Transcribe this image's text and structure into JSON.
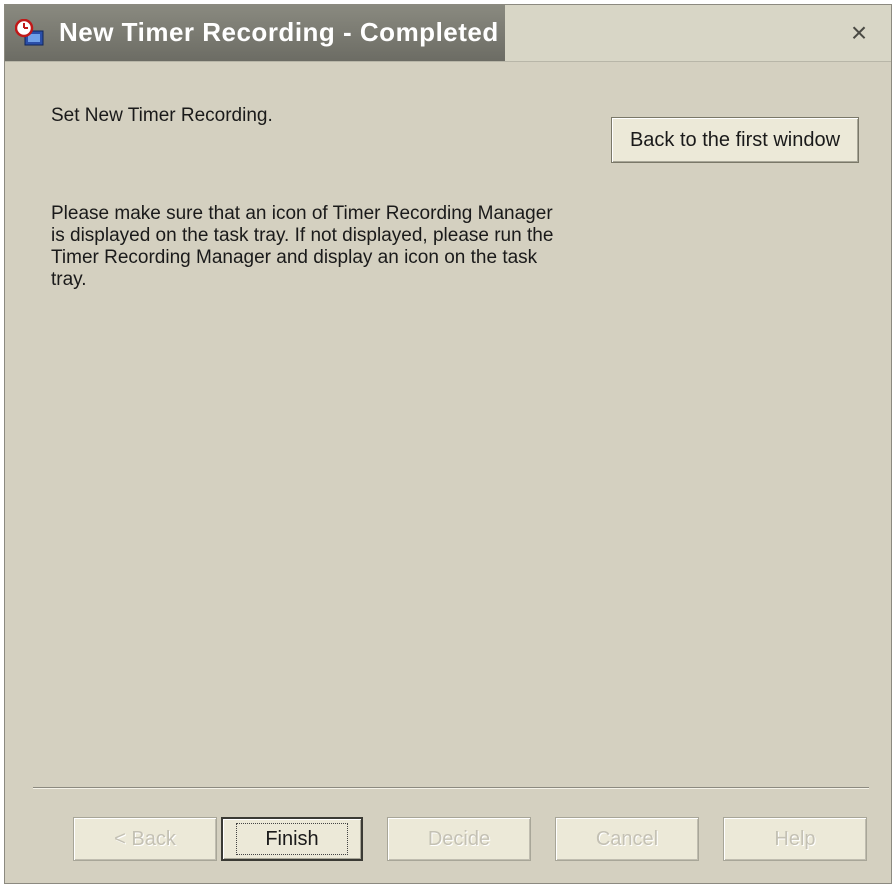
{
  "window": {
    "title": "New Timer Recording - Completed",
    "close_glyph": "×"
  },
  "content": {
    "status": "Set New Timer Recording.",
    "back_first_label": "Back to the first window",
    "info": "Please make sure that an icon of Timer Recording Manager is displayed on the task tray. If not displayed, please run the Timer Recording Manager and display an icon on the task tray."
  },
  "buttons": {
    "back": "< Back",
    "finish": "Finish",
    "decide": "Decide",
    "cancel": "Cancel",
    "help": "Help"
  },
  "icons": {
    "app": "timer-recording-icon",
    "close": "close-icon"
  }
}
